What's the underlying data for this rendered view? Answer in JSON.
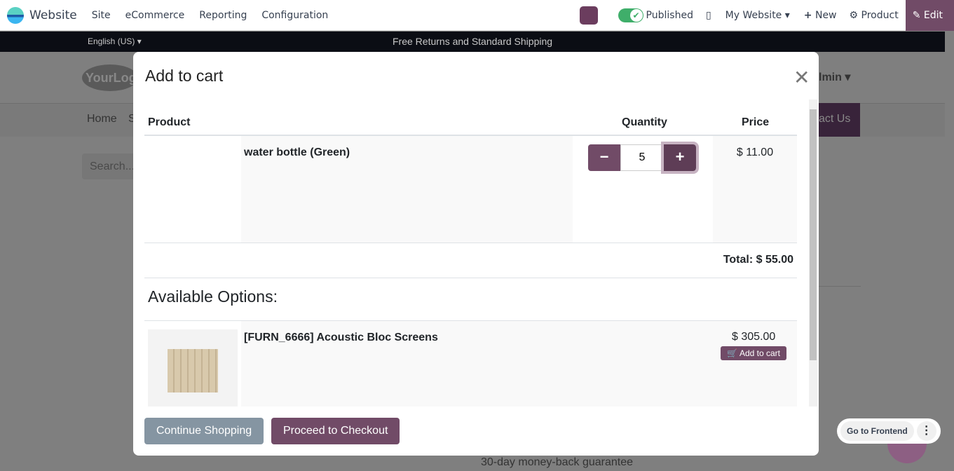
{
  "navbar": {
    "brand": "Website",
    "menu": [
      "Site",
      "eCommerce",
      "Reporting",
      "Configuration"
    ],
    "published": "Published",
    "my_website": "My Website",
    "new": "New",
    "product": "Product",
    "edit": "Edit"
  },
  "site": {
    "language": "English (US)",
    "announcement": "Free Returns and Standard Shipping",
    "logo": "YourLogo",
    "admin": "lmin",
    "home": "Home",
    "s": "S",
    "contact": "act Us",
    "search": "Search...",
    "guarantee": "30-day money-back guarantee"
  },
  "modal": {
    "title": "Add to cart",
    "headers": {
      "product": "Product",
      "quantity": "Quantity",
      "price": "Price"
    },
    "item": {
      "name": "water bottle (Green)",
      "quantity": "5",
      "price": "$ 11.00"
    },
    "total": "Total: $ 55.00",
    "options_title": "Available Options:",
    "option": {
      "name": "[FURN_6666] Acoustic Bloc Screens",
      "price": "$ 305.00",
      "add_label": "Add to cart"
    },
    "continue": "Continue Shopping",
    "checkout": "Proceed to Checkout"
  },
  "frontend": {
    "label": "Go to Frontend"
  },
  "colors": {
    "primary": "#714b67",
    "secondary": "#8595a2"
  }
}
